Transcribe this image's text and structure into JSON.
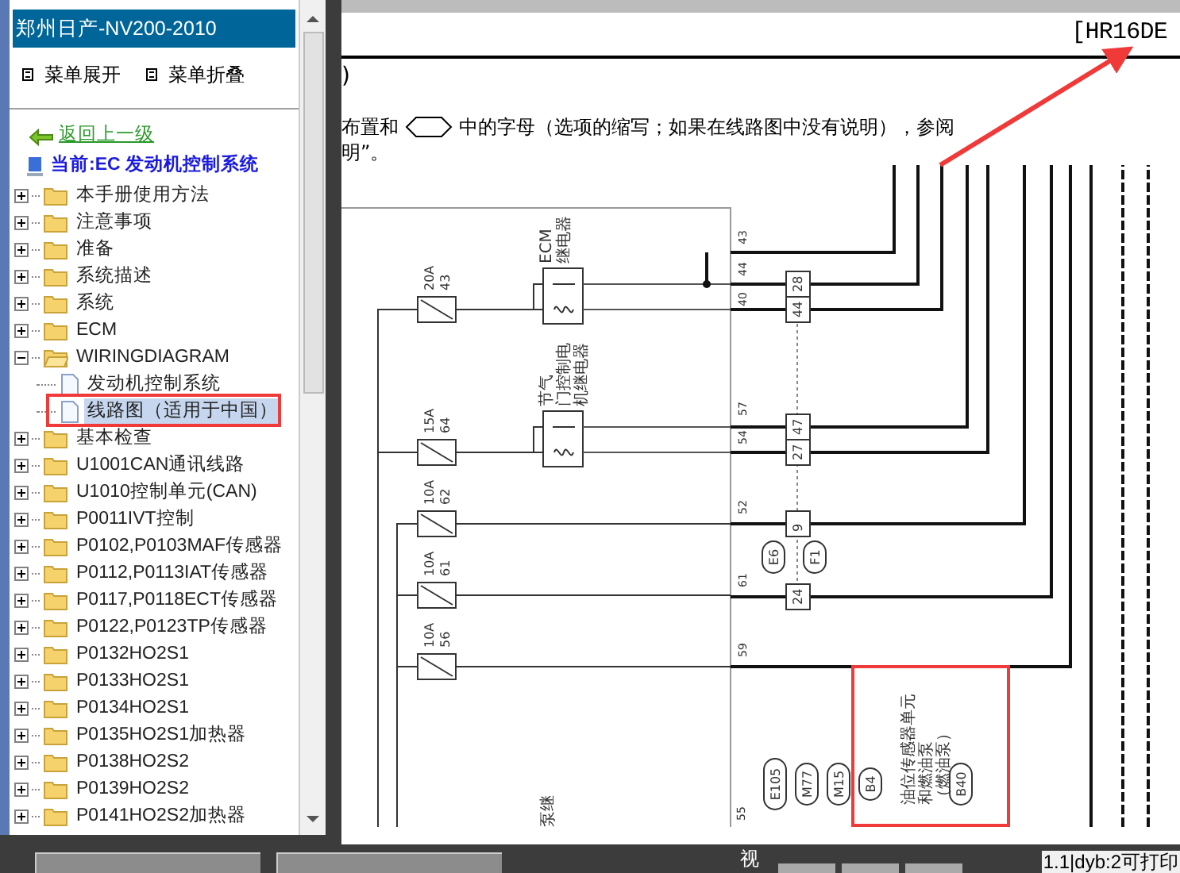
{
  "sidebar": {
    "title": "郑州日产-NV200-2010",
    "menu_buttons": [
      {
        "label": "菜单展开"
      },
      {
        "label": "菜单折叠"
      }
    ],
    "back_link": "返回上一级",
    "current": "当前:EC 发动机控制系统",
    "tree": [
      {
        "label": "本手册使用方法",
        "expanded": false
      },
      {
        "label": "注意事项",
        "expanded": false
      },
      {
        "label": "准备",
        "expanded": false
      },
      {
        "label": "系统描述",
        "expanded": false
      },
      {
        "label": "系统",
        "expanded": false
      },
      {
        "label": "ECM",
        "expanded": false
      },
      {
        "label": "WIRINGDIAGRAM",
        "expanded": true,
        "children": [
          {
            "label": "发动机控制系统",
            "selected": false
          },
          {
            "label": "线路图（适用于中国）",
            "selected": true
          }
        ]
      },
      {
        "label": "基本检查",
        "expanded": false
      },
      {
        "label": "U1001CAN通讯线路",
        "expanded": false
      },
      {
        "label": "U1010控制单元(CAN)",
        "expanded": false
      },
      {
        "label": "P0011IVT控制",
        "expanded": false
      },
      {
        "label": "P0102,P0103MAF传感器",
        "expanded": false
      },
      {
        "label": "P0112,P0113IAT传感器",
        "expanded": false
      },
      {
        "label": "P0117,P0118ECT传感器",
        "expanded": false
      },
      {
        "label": "P0122,P0123TP传感器",
        "expanded": false
      },
      {
        "label": "P0132HO2S1",
        "expanded": false
      },
      {
        "label": "P0133HO2S1",
        "expanded": false
      },
      {
        "label": "P0134HO2S1",
        "expanded": false
      },
      {
        "label": "P0135HO2S1加热器",
        "expanded": false
      },
      {
        "label": "P0138HO2S2",
        "expanded": false
      },
      {
        "label": "P0139HO2S2",
        "expanded": false
      },
      {
        "label": "P0141HO2S2加热器",
        "expanded": false
      }
    ]
  },
  "document": {
    "engine_code": "[HR16DE",
    "paren": ")",
    "line_1_before": "布置和",
    "line_1_after": "中的字母（选项的缩写；如果在线路图中没有说明），参阅",
    "line_2": "明”。",
    "fuses": [
      {
        "rating": "20A",
        "number": "43"
      },
      {
        "rating": "15A",
        "number": "64"
      },
      {
        "rating": "10A",
        "number": "62"
      },
      {
        "rating": "10A",
        "number": "61"
      },
      {
        "rating": "10A",
        "number": "56"
      }
    ],
    "relays": [
      {
        "label_lines": [
          "ECM",
          "继电器"
        ]
      },
      {
        "label_lines": [
          "节气",
          "门控制电",
          "机继电器"
        ]
      }
    ],
    "terminals": [
      "43",
      "44",
      "40",
      "57",
      "54",
      "52",
      "61",
      "59",
      "55"
    ],
    "pins": [
      "28",
      "44",
      "47",
      "27",
      "9",
      "24"
    ],
    "connectors": [
      "E6",
      "F1",
      "E105",
      "M77",
      "M15",
      "B4",
      "B40"
    ],
    "fuel_unit_lines": [
      "油位传感器单元",
      "和燃油泵",
      "（燃油泵）"
    ],
    "pump_label": "泵继"
  },
  "status_bar": {
    "view": "视",
    "page_info": "1.1|dyb:2可打印"
  }
}
